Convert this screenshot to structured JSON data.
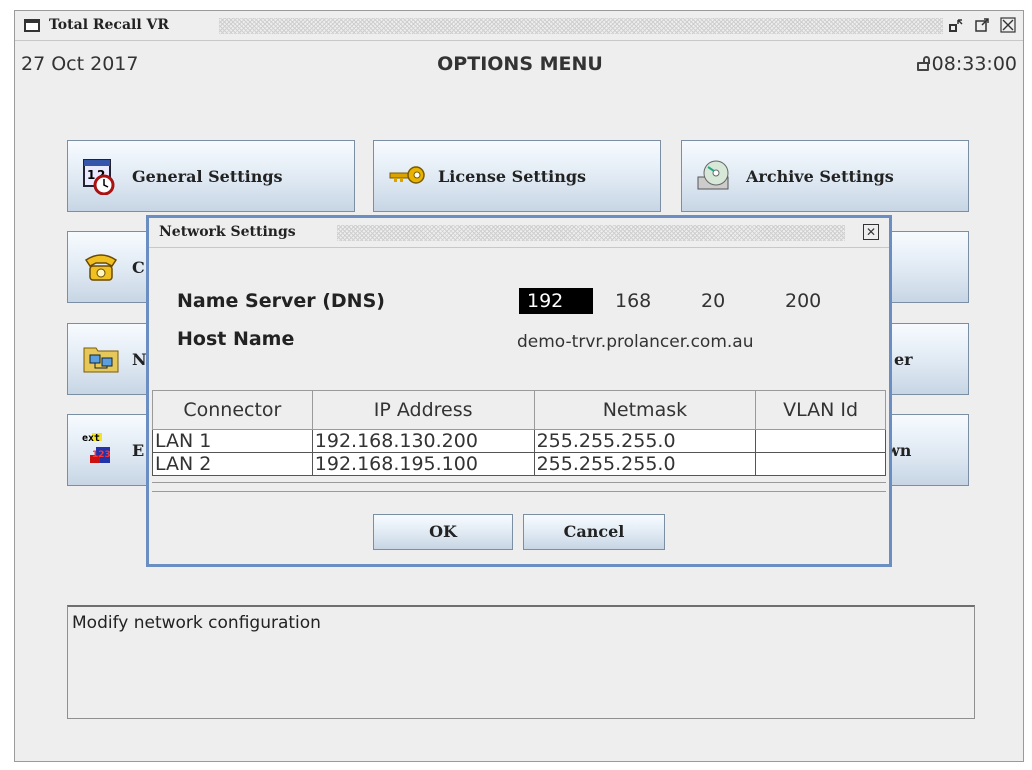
{
  "window": {
    "title": "Total Recall VR"
  },
  "header": {
    "date": "27 Oct 2017",
    "title": "OPTIONS MENU",
    "time": "08:33:00"
  },
  "menu": {
    "general": "General Settings",
    "license": "License Settings",
    "archive": "Archive Settings",
    "row2_left_partial": "C",
    "row3_left_partial": "N",
    "row3_right_partial": "er",
    "row4_left_partial": "E",
    "row4_right_partial": "wn"
  },
  "description": "Modify network configuration",
  "dialog": {
    "title": "Network Settings",
    "dns_label": "Name Server (DNS)",
    "dns": [
      "192",
      "168",
      "20",
      "200"
    ],
    "host_label": "Host Name",
    "host": "demo-trvr.prolancer.com.au",
    "columns": [
      "Connector",
      "IP Address",
      "Netmask",
      "VLAN Id"
    ],
    "rows": [
      [
        "LAN 1",
        "192.168.130.200",
        "255.255.255.0",
        ""
      ],
      [
        "LAN 2",
        "192.168.195.100",
        "255.255.255.0",
        ""
      ]
    ],
    "ok": "OK",
    "cancel": "Cancel"
  },
  "icons": {
    "ext_text": "ext",
    "num_text": "123"
  }
}
